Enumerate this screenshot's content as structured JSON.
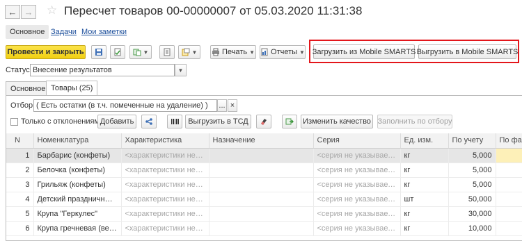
{
  "window": {
    "title": "Пересчет товаров 00-00000007 от 05.03.2020 11:31:38"
  },
  "nav_tabs": [
    {
      "label": "Основное"
    },
    {
      "label": "Задачи"
    },
    {
      "label": "Мои заметки"
    }
  ],
  "toolbar": {
    "post_close_label": "Провести и закрыть",
    "print_label": "Печать",
    "reports_label": "Отчеты",
    "load_mobile_label": "Загрузить из Mobile SMARTS",
    "unload_mobile_label": "Выгрузить в Mobile SMARTS"
  },
  "status": {
    "label": "Статус:",
    "value": "Внесение результатов"
  },
  "doc_tabs": [
    {
      "label": "Основное"
    },
    {
      "label": "Товары (25)"
    }
  ],
  "filter": {
    "label": "Отбор:",
    "value": "( Есть остатки (в т.ч. помеченные на удаление) )",
    "more": "...",
    "clear": "×"
  },
  "goods_toolbar": {
    "only_deviations_label": "Только с отклонениями",
    "add_label": "Добавить",
    "unload_tsd_label": "Выгрузить в ТСД",
    "change_quality_label": "Изменить качество",
    "fill_by_filter_label": "Заполнить по отбору"
  },
  "table": {
    "columns": [
      "N",
      "Номенклатура",
      "Характеристика",
      "Назначение",
      "Серия",
      "Ед. изм.",
      "По учету",
      "По фа"
    ],
    "rows": [
      {
        "n": "1",
        "name": "Барбарис (конфеты)",
        "char": "<характеристики не исп...",
        "purpose": "",
        "series": "<серия не указывается>",
        "unit": "кг",
        "qty": "5,000",
        "fact": ""
      },
      {
        "n": "2",
        "name": "Белочка (конфеты)",
        "char": "<характеристики не исп...",
        "purpose": "",
        "series": "<серия не указывается>",
        "unit": "кг",
        "qty": "5,000",
        "fact": ""
      },
      {
        "n": "3",
        "name": "Грильяж (конфеты)",
        "char": "<характеристики не исп...",
        "purpose": "",
        "series": "<серия не указывается>",
        "unit": "кг",
        "qty": "5,000",
        "fact": ""
      },
      {
        "n": "4",
        "name": "Детский праздничный н...",
        "char": "<характеристики не исп...",
        "purpose": "",
        "series": "<серия не указывается>",
        "unit": "шт",
        "qty": "50,000",
        "fact": ""
      },
      {
        "n": "5",
        "name": "Крупа \"Геркулес\"",
        "char": "<характеристики не исп...",
        "purpose": "",
        "series": "<серия не указывается>",
        "unit": "кг",
        "qty": "30,000",
        "fact": ""
      },
      {
        "n": "6",
        "name": "Крупа гречневая (весов...",
        "char": "<характеристики не исп...",
        "purpose": "",
        "series": "<серия не указывается>",
        "unit": "кг",
        "qty": "10,000",
        "fact": ""
      }
    ]
  },
  "colors": {
    "accent_yellow": "#f1cf12",
    "highlight_red": "#e3161b",
    "link_blue": "#1b4e9b"
  }
}
